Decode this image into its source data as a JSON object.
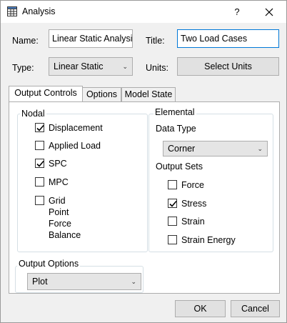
{
  "window": {
    "title": "Analysis",
    "help_label": "?"
  },
  "form": {
    "name_label": "Name:",
    "name_value": "Linear Static Analysis",
    "title_label": "Title:",
    "title_value": "Two Load Cases",
    "type_label": "Type:",
    "type_value": "Linear Static",
    "units_label": "Units:",
    "units_button": "Select Units"
  },
  "tabs": [
    {
      "label": "Output Controls",
      "active": true
    },
    {
      "label": "Options",
      "active": false
    },
    {
      "label": "Model State",
      "active": false
    }
  ],
  "nodal": {
    "title": "Nodal",
    "items": [
      {
        "label": "Displacement",
        "checked": true
      },
      {
        "label": "Applied Load",
        "checked": false
      },
      {
        "label": "SPC",
        "checked": true
      },
      {
        "label": "MPC",
        "checked": false
      },
      {
        "label": "Grid Point Force\nBalance",
        "checked": false
      }
    ]
  },
  "elemental": {
    "title": "Elemental",
    "data_type_label": "Data Type",
    "data_type_value": "Corner",
    "output_sets_label": "Output Sets",
    "items": [
      {
        "label": "Force",
        "checked": false
      },
      {
        "label": "Stress",
        "checked": true
      },
      {
        "label": "Strain",
        "checked": false
      },
      {
        "label": "Strain Energy",
        "checked": false
      }
    ]
  },
  "output_options": {
    "title": "Output Options",
    "value": "Plot"
  },
  "buttons": {
    "ok": "OK",
    "cancel": "Cancel"
  }
}
